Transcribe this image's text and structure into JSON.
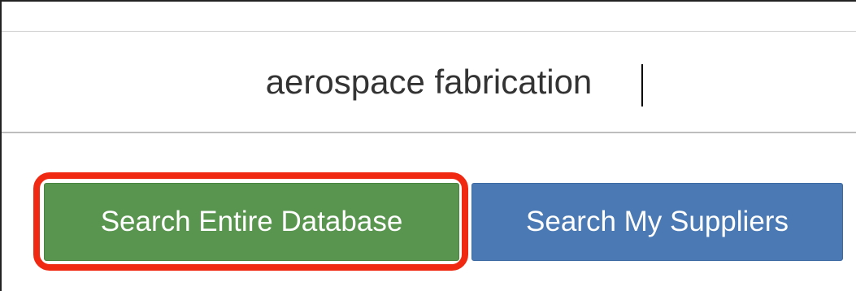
{
  "search": {
    "value": "aerospace fabrication",
    "placeholder": ""
  },
  "actions": {
    "search_all_label": "Search Entire Database",
    "search_suppliers_label": "Search My Suppliers"
  },
  "colors": {
    "search_all_button": "#5a9550",
    "search_suppliers_button": "#4a79b4",
    "highlight": "#f02a12"
  }
}
